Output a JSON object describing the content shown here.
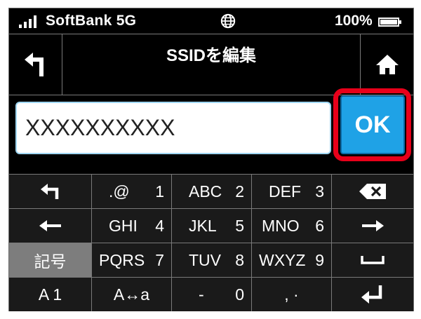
{
  "status_bar": {
    "carrier": "SoftBank 5G",
    "battery_percent": "100%",
    "battery_level": 1.0,
    "signal_icon": "signal-bars-icon",
    "network_icon": "globe-icon"
  },
  "header": {
    "title": "SSIDを編集",
    "back_icon": "back-arrow-icon",
    "home_icon": "home-icon"
  },
  "ssid_field": {
    "value": "XXXXXXXXXX"
  },
  "ok_button": {
    "label": "OK",
    "color": "#1fa2e6",
    "highlight_color": "#e8001a"
  },
  "keypad": {
    "row1": {
      "k2": {
        "main": ".@",
        "num": "1"
      },
      "k3": {
        "main": "ABC",
        "num": "2"
      },
      "k4": {
        "main": "DEF",
        "num": "3"
      }
    },
    "row2": {
      "k2": {
        "main": "GHI",
        "num": "4"
      },
      "k3": {
        "main": "JKL",
        "num": "5"
      },
      "k4": {
        "main": "MNO",
        "num": "6"
      }
    },
    "row3": {
      "k1": {
        "main": "記号"
      },
      "k2": {
        "main": "PQRS",
        "num": "7"
      },
      "k3": {
        "main": "TUV",
        "num": "8"
      },
      "k4": {
        "main": "WXYZ",
        "num": "9"
      }
    },
    "row4": {
      "k1": {
        "main": "A 1"
      },
      "k2": {
        "main": "A↔a"
      },
      "k3": {
        "main": "-",
        "num": "0"
      },
      "k4": {
        "main": ", ·"
      }
    },
    "icons": {
      "undo": "undo-icon",
      "backspace": "backspace-icon",
      "left": "arrow-left-icon",
      "right": "arrow-right-icon",
      "space": "space-icon",
      "enter": "enter-icon"
    }
  }
}
